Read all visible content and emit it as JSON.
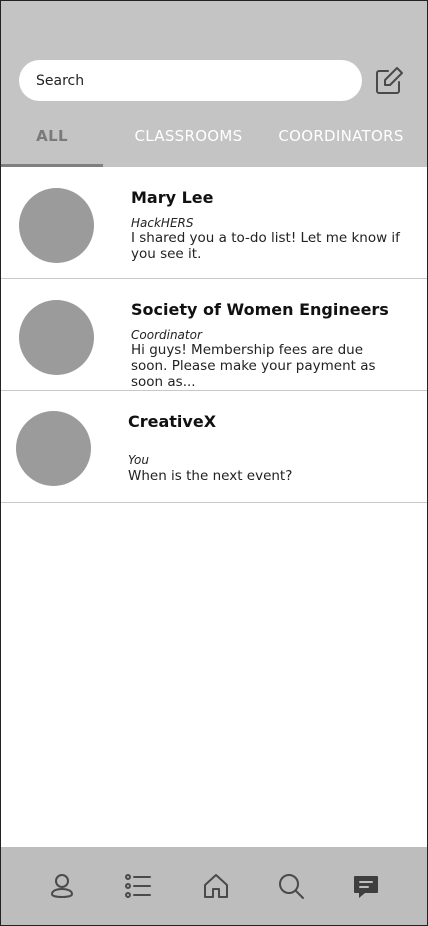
{
  "search": {
    "placeholder": "Search"
  },
  "tabs": [
    {
      "label": "ALL",
      "active": true
    },
    {
      "label": "CLASSROOMS",
      "active": false
    },
    {
      "label": "COORDINATORS",
      "active": false
    }
  ],
  "conversations": [
    {
      "name": "Mary Lee",
      "subtitle": "HackHERS",
      "message": "I shared you a to-do list! Let me know if you see it."
    },
    {
      "name": "Society of Women Engineers",
      "subtitle": "Coordinator",
      "message": "Hi guys! Membership fees are due soon. Please make your payment as soon as..."
    },
    {
      "name": "CreativeX",
      "subtitle": "You",
      "message": "When is the next event?"
    }
  ],
  "icons": {
    "compose": "compose-icon",
    "nav": [
      "profile-icon",
      "list-icon",
      "home-icon",
      "search-icon",
      "chat-icon"
    ]
  },
  "colors": {
    "header_bg": "#c4c4c4",
    "avatar": "#9b9b9b",
    "nav_bg": "#bdbdbd",
    "active_tab": "#7a7a7a"
  }
}
